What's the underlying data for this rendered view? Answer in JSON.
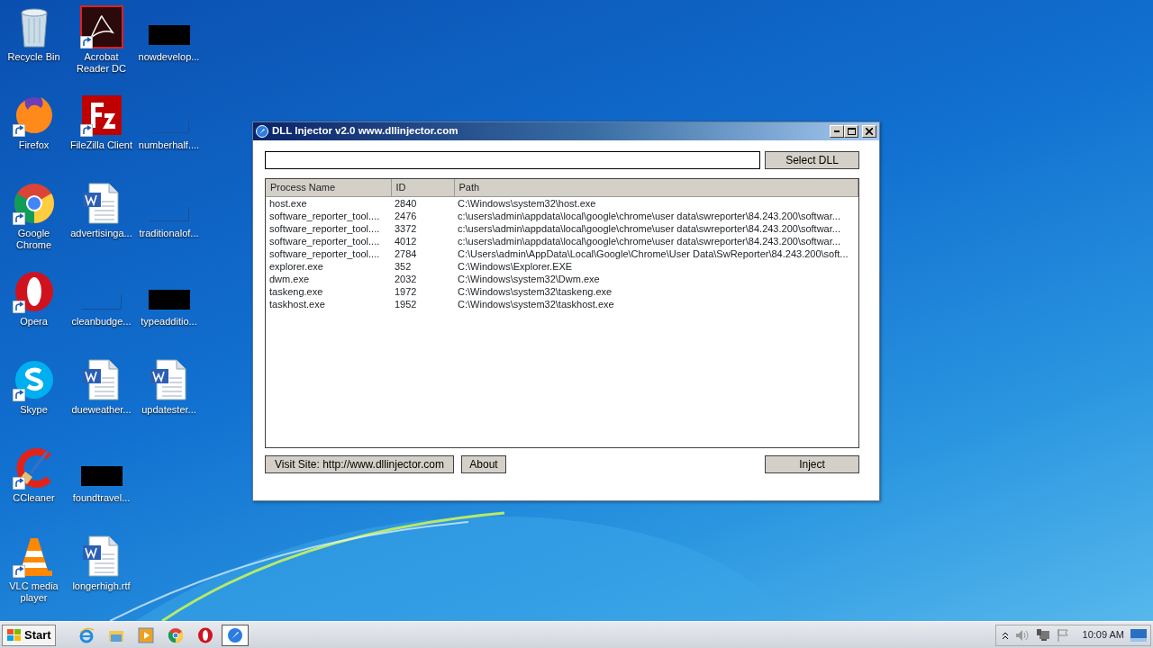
{
  "desktop_icons": [
    {
      "label": "Recycle Bin",
      "kind": "recycle",
      "shortcut": false
    },
    {
      "label": "Firefox",
      "kind": "firefox",
      "shortcut": true
    },
    {
      "label": "Google Chrome",
      "kind": "chrome",
      "shortcut": true
    },
    {
      "label": "Opera",
      "kind": "opera",
      "shortcut": true
    },
    {
      "label": "Skype",
      "kind": "skype",
      "shortcut": true
    },
    {
      "label": "CCleaner",
      "kind": "ccleaner",
      "shortcut": true
    },
    {
      "label": "VLC media player",
      "kind": "vlc",
      "shortcut": true
    },
    {
      "label": "Acrobat Reader DC",
      "kind": "acrobat",
      "shortcut": true
    },
    {
      "label": "FileZilla Client",
      "kind": "filezilla",
      "shortcut": true
    },
    {
      "label": "advertisinga...",
      "kind": "word",
      "shortcut": false
    },
    {
      "label": "cleanbudge...",
      "kind": "blank",
      "shortcut": false
    },
    {
      "label": "dueweather...",
      "kind": "word",
      "shortcut": false
    },
    {
      "label": "foundtravel...",
      "kind": "black",
      "shortcut": false
    },
    {
      "label": "longerhigh.rtf",
      "kind": "word",
      "shortcut": false
    },
    {
      "label": "nowdevelop...",
      "kind": "black",
      "shortcut": false
    },
    {
      "label": "numberhalf....",
      "kind": "blank",
      "shortcut": false
    },
    {
      "label": "traditionalof...",
      "kind": "blank",
      "shortcut": false
    },
    {
      "label": "typeadditio...",
      "kind": "black",
      "shortcut": false
    },
    {
      "label": "updatester...",
      "kind": "word",
      "shortcut": false
    }
  ],
  "window": {
    "title": "DLL Injector v2.0 www.dllinjector.com",
    "select_button": "Select DLL",
    "table": {
      "columns": [
        "Process Name",
        "ID",
        "Path"
      ],
      "rows": [
        [
          "host.exe",
          "2840",
          "C:\\Windows\\system32\\host.exe"
        ],
        [
          "software_reporter_tool....",
          "2476",
          "c:\\users\\admin\\appdata\\local\\google\\chrome\\user data\\swreporter\\84.243.200\\softwar..."
        ],
        [
          "software_reporter_tool....",
          "3372",
          "c:\\users\\admin\\appdata\\local\\google\\chrome\\user data\\swreporter\\84.243.200\\softwar..."
        ],
        [
          "software_reporter_tool....",
          "4012",
          "c:\\users\\admin\\appdata\\local\\google\\chrome\\user data\\swreporter\\84.243.200\\softwar..."
        ],
        [
          "software_reporter_tool....",
          "2784",
          "C:\\Users\\admin\\AppData\\Local\\Google\\Chrome\\User Data\\SwReporter\\84.243.200\\soft..."
        ],
        [
          "explorer.exe",
          "352",
          "C:\\Windows\\Explorer.EXE"
        ],
        [
          "dwm.exe",
          "2032",
          "C:\\Windows\\system32\\Dwm.exe"
        ],
        [
          "taskeng.exe",
          "1972",
          "C:\\Windows\\system32\\taskeng.exe"
        ],
        [
          "taskhost.exe",
          "1952",
          "C:\\Windows\\system32\\taskhost.exe"
        ]
      ]
    },
    "visit_button": "Visit Site: http://www.dllinjector.com",
    "about_button": "About",
    "inject_button": "Inject"
  },
  "taskbar": {
    "start": "Start",
    "items": [
      {
        "kind": "ie",
        "selected": false
      },
      {
        "kind": "folder",
        "selected": false
      },
      {
        "kind": "media",
        "selected": false
      },
      {
        "kind": "chrome",
        "selected": false
      },
      {
        "kind": "opera",
        "selected": false
      },
      {
        "kind": "injector",
        "selected": true
      }
    ],
    "clock": "10:09 AM"
  }
}
